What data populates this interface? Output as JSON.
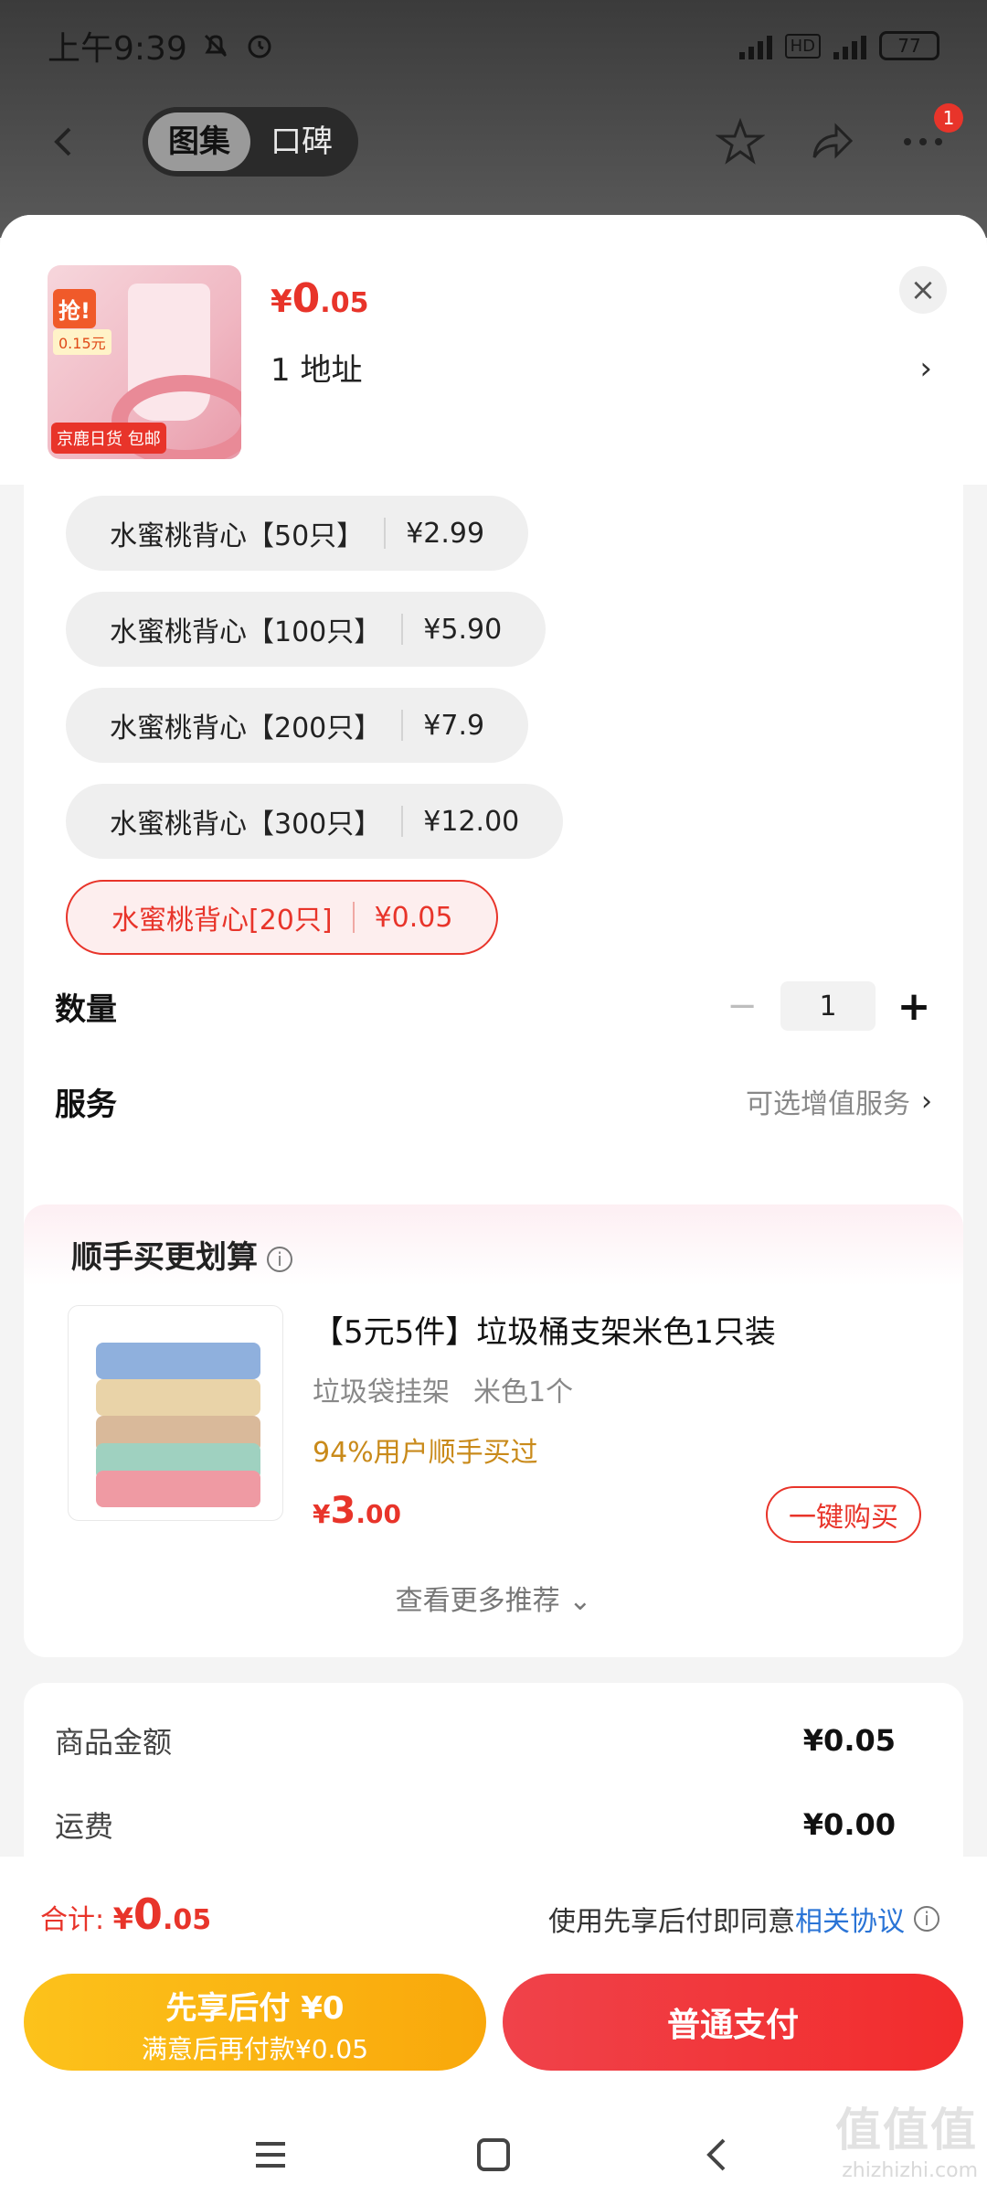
{
  "status_bar": {
    "time": "上午9:39",
    "hd_label": "HD",
    "battery": "77"
  },
  "top_nav": {
    "tabs": [
      "图集",
      "口碑"
    ],
    "active_tab": 0,
    "badge_count": "1"
  },
  "product": {
    "thumb_tags": [
      "抢!",
      "0.15元",
      "京鹿日货 包邮"
    ],
    "price_symbol": "¥",
    "price_int": "0",
    "price_dec": ".05",
    "address": "1  地址",
    "close": "×"
  },
  "specs": [
    {
      "name": "水蜜桃背心【50只】",
      "price": "¥2.99",
      "selected": false
    },
    {
      "name": "水蜜桃背心【100只】",
      "price": "¥5.90",
      "selected": false
    },
    {
      "name": "水蜜桃背心【200只】",
      "price": "¥7.9",
      "selected": false
    },
    {
      "name": "水蜜桃背心【300只】",
      "price": "¥12.00",
      "selected": false
    },
    {
      "name": "水蜜桃背心[20只]",
      "price": "¥0.05",
      "selected": true
    }
  ],
  "quantity": {
    "label": "数量",
    "minus": "−",
    "value": "1",
    "plus": "+"
  },
  "service": {
    "label": "服务",
    "hint": "可选增值服务",
    "chevron": "›"
  },
  "recommend": {
    "title": "顺手买更划算",
    "info": "i",
    "item_name": "【5元5件】垃圾桶支架米色1只装",
    "item_attrs": [
      "垃圾袋挂架",
      "米色1个"
    ],
    "item_pct": "94%用户顺手买过",
    "price_symbol": "¥",
    "price_int": "3",
    "price_dec": ".00",
    "buy_label": "一键购买",
    "more_label": "查看更多推荐 ⌄"
  },
  "summary": {
    "rows": [
      {
        "label": "商品金额",
        "value": "¥0.05"
      },
      {
        "label": "运费",
        "value": "¥0.00"
      }
    ]
  },
  "bottom": {
    "total_label": "合计: ",
    "total_symbol": "¥",
    "total_int": "0",
    "total_dec": ".05",
    "agree_prefix": "使用先享后付即同意",
    "agree_link": "相关协议",
    "later_line1": "先享后付 ¥0",
    "later_line2": "满意后再付款¥0.05",
    "pay_label": "普通支付"
  },
  "watermark": {
    "big": "值值值",
    "small": "zhizhizhi.com"
  },
  "colors": {
    "accent": "#e8342a",
    "link": "#2a74d6",
    "gold": "#c98a1a",
    "later_button": "#fcc21b",
    "pay_button": "#f0424a"
  }
}
